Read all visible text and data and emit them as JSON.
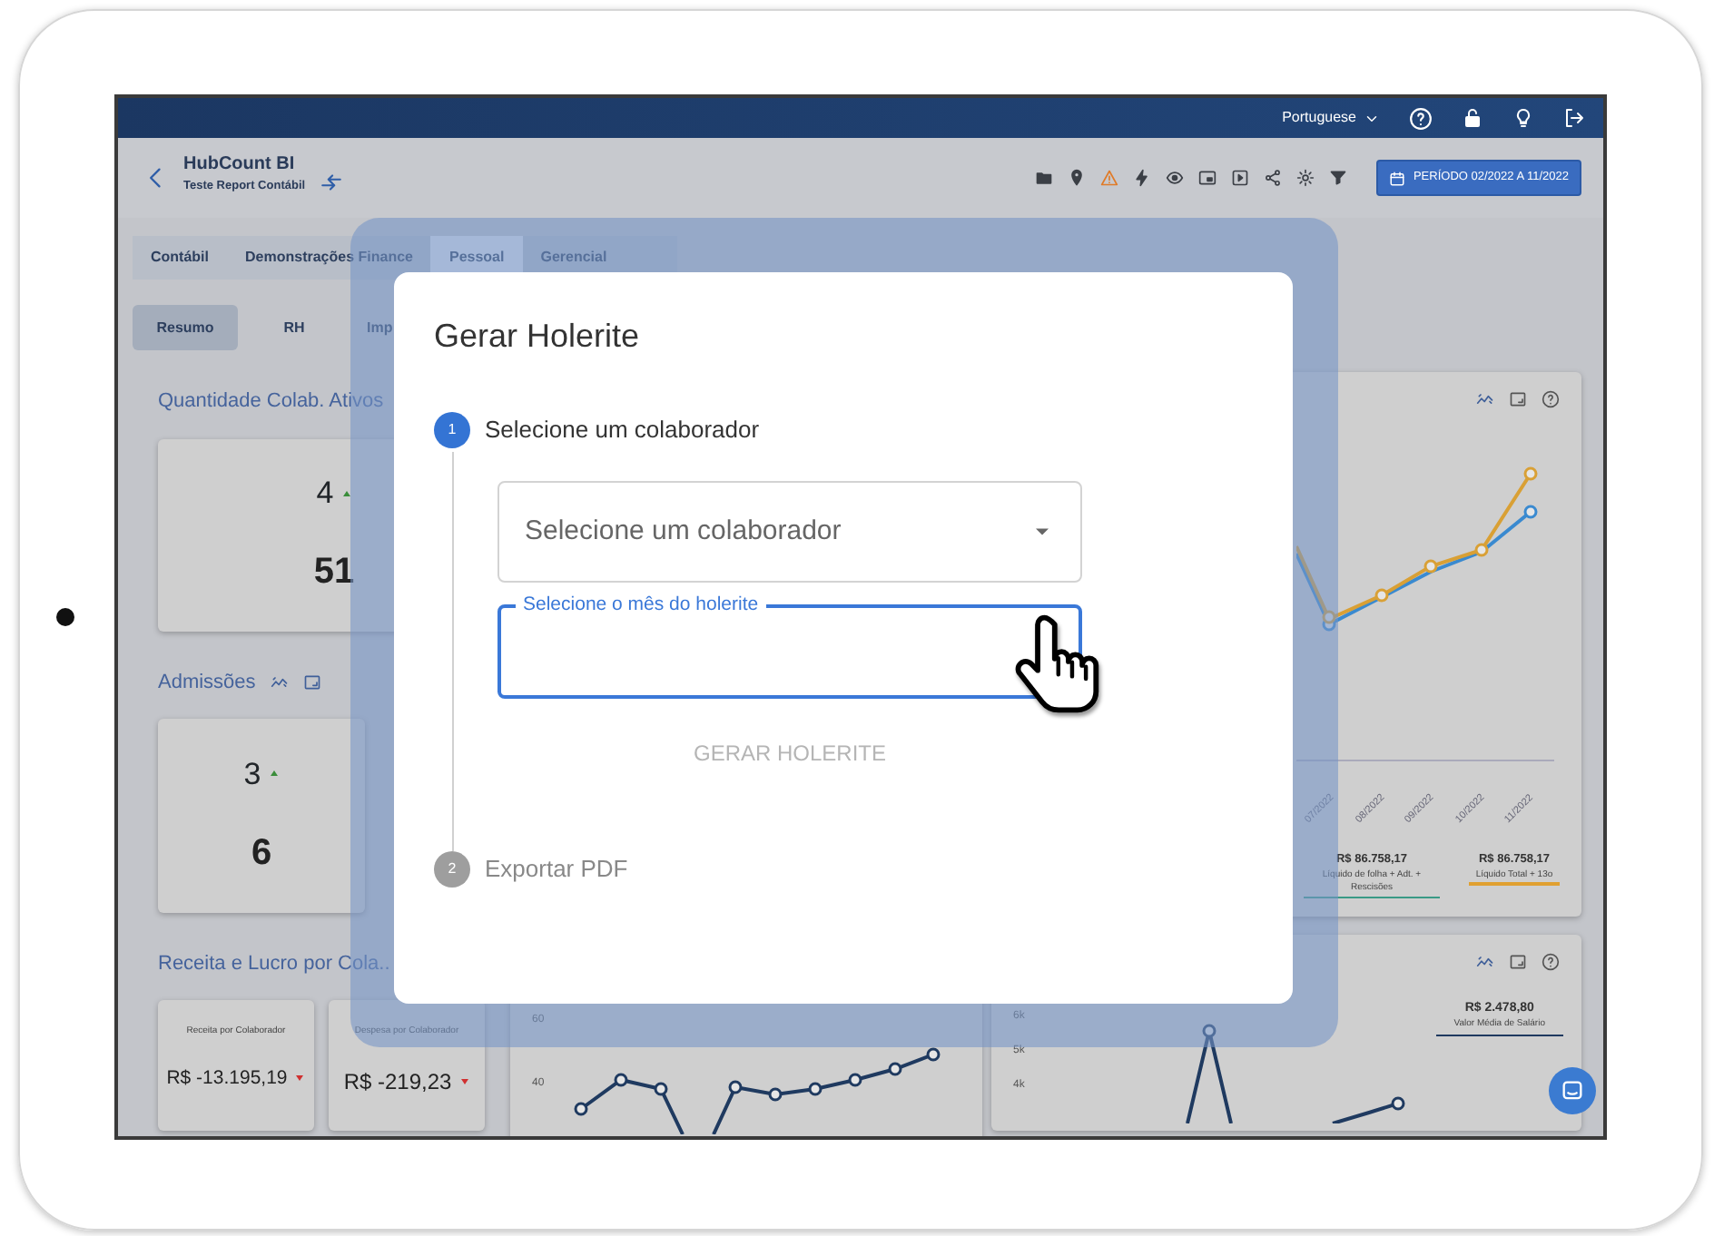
{
  "top_bar": {
    "language": "Portuguese"
  },
  "header": {
    "title": "HubCount BI",
    "subtitle": "Teste Report Contábil",
    "period_button": "PERÍODO 02/2022 A 11/2022"
  },
  "tabs": [
    {
      "label": "Contábil",
      "selected": false
    },
    {
      "label": "Demonstrações Finance",
      "selected": false
    },
    {
      "label": "Pessoal",
      "selected": true
    },
    {
      "label": "Gerencial",
      "selected": false
    }
  ],
  "subtabs": [
    {
      "label": "Resumo",
      "selected": true
    },
    {
      "label": "RH",
      "selected": false
    },
    {
      "label": "Imp",
      "selected": false
    }
  ],
  "widgets": [
    {
      "kind": "kpi",
      "title": "Quantidade Colab. Ativos",
      "toolbar": false,
      "change": "4",
      "increase": true,
      "value": "51"
    },
    {
      "kind": "kpi",
      "title": "Admissões",
      "toolbar": true,
      "change": "3",
      "increase": true,
      "value": "6"
    },
    {
      "kind": "money_pair",
      "title": "Receita e Lucro por Cola..",
      "cards": [
        {
          "label": "Receita por Colaborador",
          "value": "R$ -13.195,19",
          "increase": false
        },
        {
          "label": "Despesa por Colaborador",
          "value": "R$ -219,23",
          "increase": false
        }
      ]
    }
  ],
  "middle_chart": {
    "y_labels": [
      "60",
      "40"
    ]
  },
  "payroll_chart": {
    "x_labels": [
      "07/2022",
      "08/2022",
      "09/2022",
      "10/2022",
      "11/2022"
    ],
    "legend": [
      {
        "value": "R$ 86.758,17",
        "label": "Líquido de folha + Adt. + Rescisões",
        "color": "#3a9a86"
      },
      {
        "value": "R$ 86.758,17",
        "label": "Líquido Total + 13o",
        "color": "#e0a030"
      }
    ]
  },
  "salary_chart": {
    "value": "R$ 2.478,80",
    "label": "Valor Média de Salário",
    "y_labels": [
      "6k",
      "5k",
      "4k"
    ]
  },
  "dialog": {
    "title": "Gerar Holerite",
    "steps": [
      {
        "number": "1",
        "label": "Selecione um colaborador",
        "active": true
      },
      {
        "number": "2",
        "label": "Exportar PDF",
        "active": false
      }
    ],
    "employee_select": {
      "placeholder": "Selecione um colaborador"
    },
    "month_field": {
      "label": "Selecione o mês do holerite",
      "focused": true
    },
    "submit_button": {
      "label": "GERAR HOLERITE",
      "disabled": true
    }
  }
}
